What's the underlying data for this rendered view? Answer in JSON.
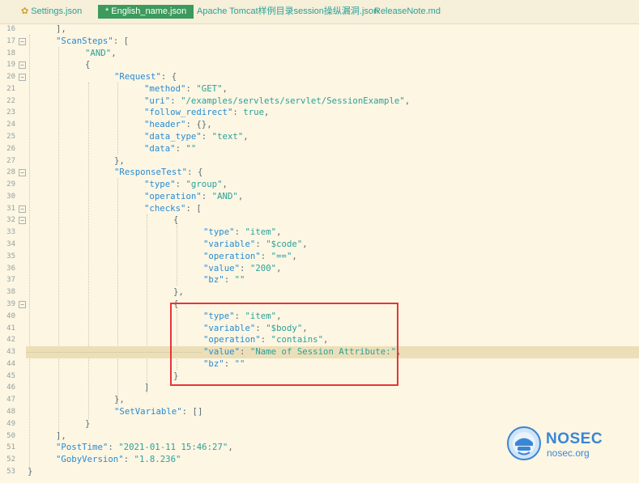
{
  "tabs": [
    {
      "label": "Settings.json",
      "icon": "gear-icon",
      "active": false
    },
    {
      "label": "English_name.json",
      "modified_marker": "*",
      "active": true
    },
    {
      "label": "Apache Tomcat样例目录session操纵漏洞.json",
      "active": false
    },
    {
      "label": "ReleaseNote.md",
      "active": false
    }
  ],
  "line_numbers": [
    "16",
    "17",
    "18",
    "19",
    "20",
    "21",
    "22",
    "23",
    "24",
    "25",
    "26",
    "27",
    "28",
    "29",
    "30",
    "31",
    "32",
    "33",
    "34",
    "35",
    "36",
    "37",
    "38",
    "39",
    "40",
    "41",
    "42",
    "43",
    "44",
    "45",
    "46",
    "47",
    "48",
    "49",
    "50",
    "51",
    "52",
    "53"
  ],
  "fold_marker": "−",
  "code": {
    "l16": "],",
    "l17_key": "\"ScanSteps\"",
    "l17_rest": ": [",
    "l18": "\"AND\"",
    "l19": "{",
    "l20_key": "\"Request\"",
    "l20_rest": ": {",
    "l21_key": "\"method\"",
    "l21_val": "\"GET\"",
    "l22_key": "\"uri\"",
    "l22_val": "\"/examples/servlets/servlet/SessionExample\"",
    "l23_key": "\"follow_redirect\"",
    "l23_val": "true",
    "l24_key": "\"header\"",
    "l24_rest": ": {},",
    "l25_key": "\"data_type\"",
    "l25_val": "\"text\"",
    "l26_key": "\"data\"",
    "l26_val": "\"\"",
    "l27": "},",
    "l28_key": "\"ResponseTest\"",
    "l28_rest": ": {",
    "l29_key": "\"type\"",
    "l29_val": "\"group\"",
    "l30_key": "\"operation\"",
    "l30_val": "\"AND\"",
    "l31_key": "\"checks\"",
    "l31_rest": ": [",
    "l32": "{",
    "l33_key": "\"type\"",
    "l33_val": "\"item\"",
    "l34_key": "\"variable\"",
    "l34_val": "\"$code\"",
    "l35_key": "\"operation\"",
    "l35_val": "\"==\"",
    "l36_key": "\"value\"",
    "l36_val": "\"200\"",
    "l37_key": "\"bz\"",
    "l37_val": "\"\"",
    "l38": "},",
    "l39": "{",
    "l40_key": "\"type\"",
    "l40_val": "\"item\"",
    "l41_key": "\"variable\"",
    "l41_val": "\"$body\"",
    "l42_key": "\"operation\"",
    "l42_val": "\"contains\"",
    "l43_key": "\"value\"",
    "l43_val": "\"Name of Session Attribute:\"",
    "l44_key": "\"bz\"",
    "l44_val": "\"\"",
    "l45": "}",
    "l46": "]",
    "l47": "},",
    "l48_key": "\"SetVariable\"",
    "l48_rest": ": []",
    "l49": "}",
    "l50": "],",
    "l51_key": "\"PostTime\"",
    "l51_val": "\"2021-01-11 15:46:27\"",
    "l52_key": "\"GobyVersion\"",
    "l52_val": "\"1.8.236\"",
    "l53": "}"
  },
  "logo": {
    "title": "NOSEC",
    "subtitle": "nosec.org"
  },
  "colors": {
    "key": "#268bd2",
    "string": "#2aa198",
    "punct": "#586e75",
    "highlight_box": "#e8343a",
    "active_tab": "#3c9a5c",
    "background": "#fdf6e3"
  }
}
